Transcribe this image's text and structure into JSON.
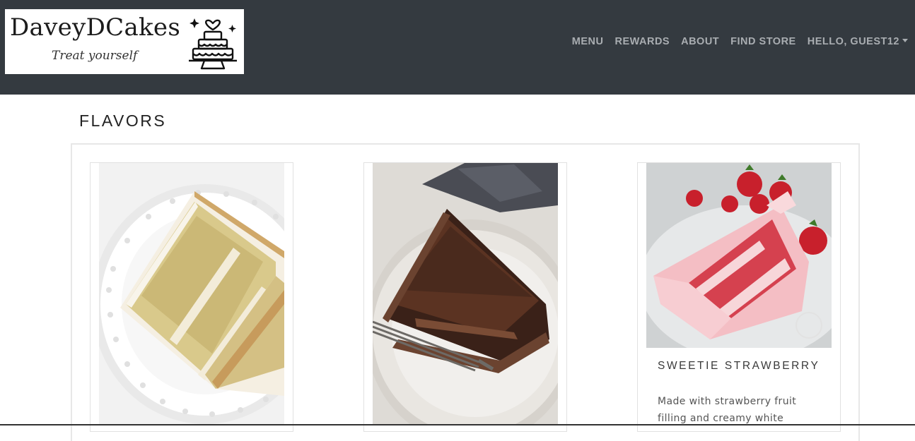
{
  "brand": {
    "name": "DaveyDCakes",
    "tagline": "Treat yourself"
  },
  "nav": {
    "items": [
      {
        "label": "MENU"
      },
      {
        "label": "REWARDS"
      },
      {
        "label": "ABOUT"
      },
      {
        "label": "FIND STORE"
      }
    ],
    "user_label": "HELLO, GUEST12"
  },
  "page": {
    "title": "FLAVORS"
  },
  "cards": [
    {
      "title": "",
      "description": ""
    },
    {
      "title": "",
      "description": ""
    },
    {
      "title": "SWEETIE STRAWBERRY",
      "description": "Made with strawberry fruit filling and creamy white"
    }
  ],
  "colors": {
    "navbar": "#343a40",
    "nav_text": "#a9adb1"
  }
}
